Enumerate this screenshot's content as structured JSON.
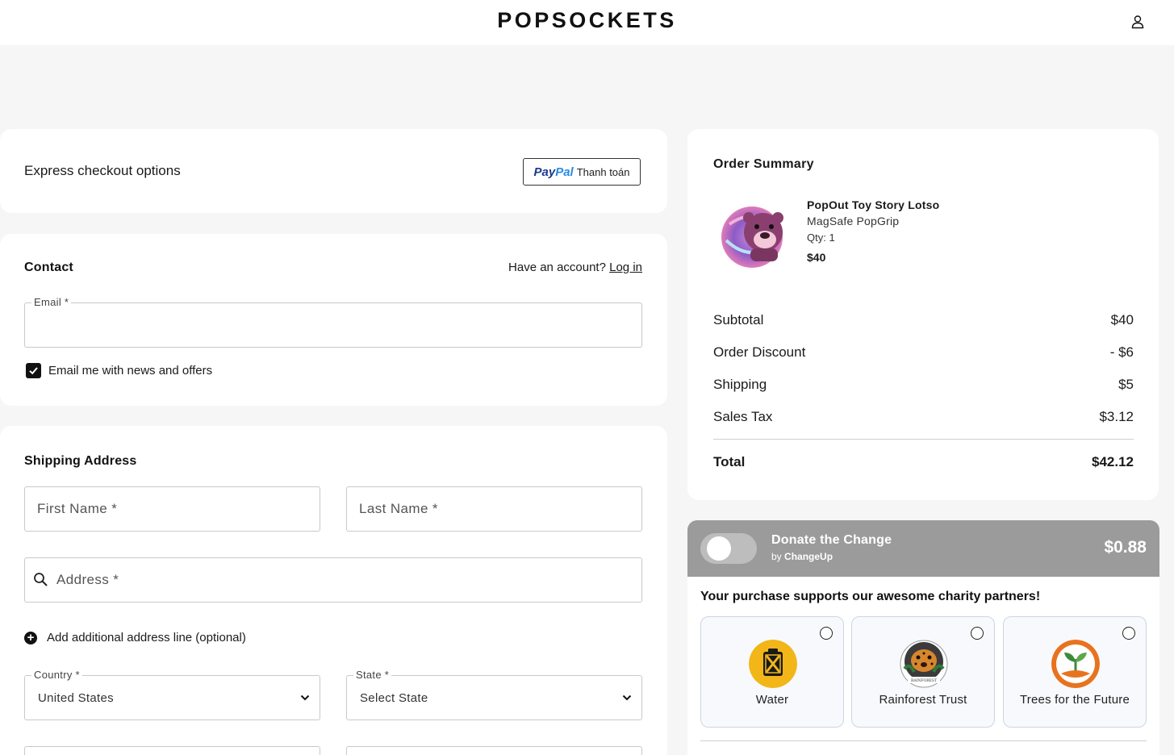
{
  "header": {
    "brand": "POPSOCKETS",
    "account_icon": "user-icon"
  },
  "express": {
    "label": "Express checkout options",
    "paypal": {
      "logo_pay": "Pay",
      "logo_pal": "Pal",
      "text": "Thanh toán"
    }
  },
  "contact": {
    "title": "Contact",
    "have_account": "Have an account?",
    "login_link": "Log in",
    "email_label": "Email *",
    "email_value": "",
    "newsletter_label": "Email me with news and offers",
    "newsletter_checked": true
  },
  "shipping": {
    "title": "Shipping Address",
    "first_name_placeholder": "First Name *",
    "last_name_placeholder": "Last Name *",
    "address_placeholder": "Address *",
    "add_line_label": "Add additional address line (optional)",
    "country_label": "Country *",
    "country_value": "United States",
    "state_label": "State *",
    "state_value": "Select State"
  },
  "summary": {
    "title": "Order Summary",
    "product": {
      "name": "PopOut Toy Story Lotso",
      "subtitle": "MagSafe PopGrip",
      "qty": "Qty: 1",
      "price": "$40"
    },
    "lines": [
      {
        "label": "Subtotal",
        "value": "$40"
      },
      {
        "label": "Order Discount",
        "value": "- $6"
      },
      {
        "label": "Shipping",
        "value": "$5"
      },
      {
        "label": "Sales Tax",
        "value": "$3.12"
      }
    ],
    "total_label": "Total",
    "total_value": "$42.12"
  },
  "donate": {
    "title": "Donate the Change",
    "by_prefix": "by",
    "by_name": "ChangeUp",
    "amount": "$0.88",
    "enabled": false,
    "heading": "Your purchase supports our awesome charity partners!",
    "charities": [
      {
        "name": "Water",
        "icon": "water-jerrycan-icon",
        "color": "#f2b619"
      },
      {
        "name": "Rainforest Trust",
        "icon": "jaguar-logo-icon",
        "color": "#3b3b3b"
      },
      {
        "name": "Trees for the Future",
        "icon": "tree-sprout-icon",
        "color": "#e8731e"
      }
    ]
  },
  "colors": {
    "donate_bar": "#9b9b9b",
    "charity_card_border": "#c9d6e6",
    "paypal_dark": "#1b3a8a",
    "paypal_light": "#2a8ce0"
  }
}
